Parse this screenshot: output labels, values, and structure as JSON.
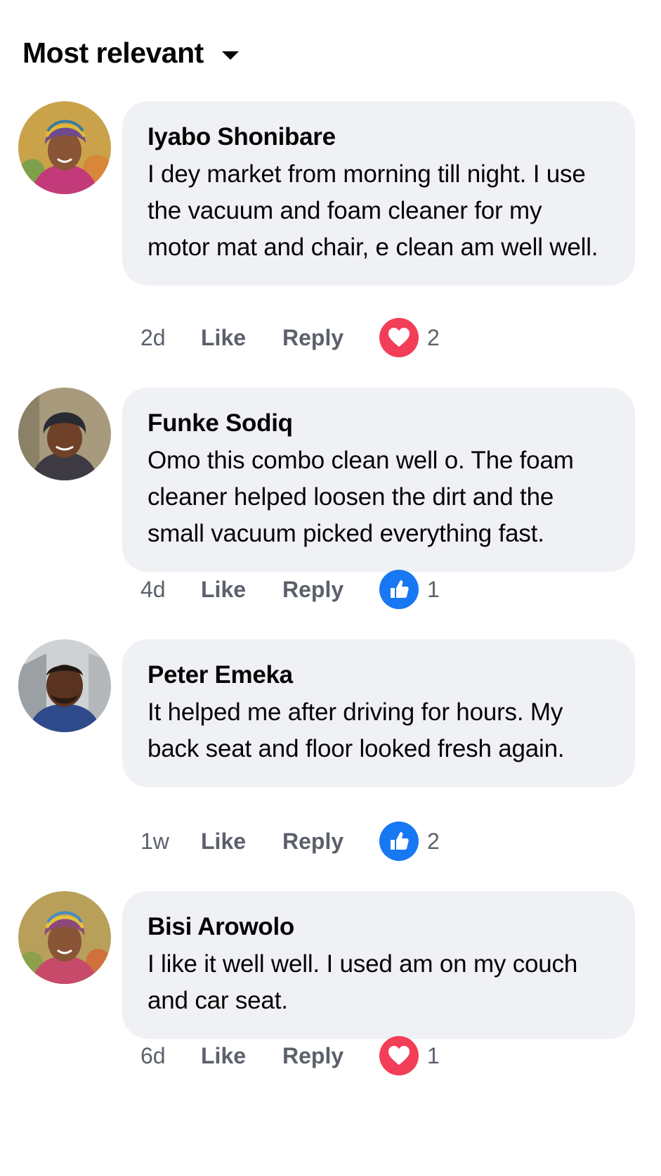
{
  "sort": {
    "label": "Most relevant"
  },
  "comments": [
    {
      "author": "Iyabo Shonibare",
      "text": "I dey market from morning till night. I use the vacuum and foam cleaner for my motor mat and chair, e clean am well well.",
      "time": "2d",
      "like_label": "Like",
      "reply_label": "Reply",
      "reaction": "love",
      "reaction_count": "2",
      "avatar": {
        "skin": "#8a5436",
        "wrap": "#6e4a8c",
        "background": "#c9a24a"
      }
    },
    {
      "author": "Funke Sodiq",
      "text": "Omo this combo clean well o. The foam cleaner helped loosen the dirt and the small vacuum picked everything fast.",
      "time": "4d",
      "like_label": "Like",
      "reply_label": "Reply",
      "reaction": "like",
      "reaction_count": "1",
      "avatar": {
        "skin": "#6e4128",
        "wrap": "#2a2a33",
        "background": "#a89a7c"
      }
    },
    {
      "author": "Peter Emeka",
      "text": "It helped me after driving for hours. My back seat and floor looked fresh again.",
      "time": "1w",
      "like_label": "Like",
      "reply_label": "Reply",
      "reaction": "like",
      "reaction_count": "2",
      "avatar": {
        "skin": "#5a3320",
        "wrap": "#1f1713",
        "background": "#cfd2d4"
      }
    },
    {
      "author": "Bisi Arowolo",
      "text": "I like it well well. I used am on my couch and car seat.",
      "time": "6d",
      "like_label": "Like",
      "reply_label": "Reply",
      "reaction": "love",
      "reaction_count": "1",
      "avatar": {
        "skin": "#8a5436",
        "wrap": "#8c4a7a",
        "background": "#b8a05a"
      }
    }
  ]
}
